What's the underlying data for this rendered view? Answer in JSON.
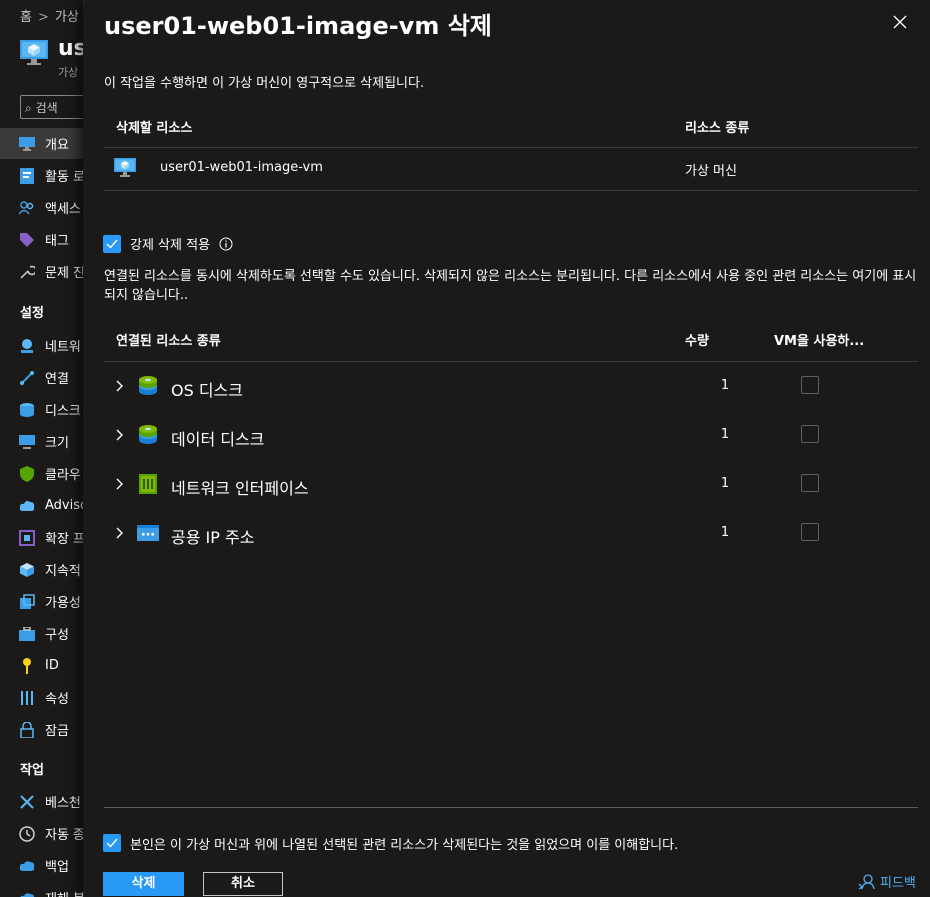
{
  "background": {
    "breadcrumb": [
      "홈",
      "가상"
    ],
    "title": "us",
    "subtitle": "가상",
    "search_placeholder": "검색",
    "nav": [
      {
        "label": "개요",
        "icon": "monitor-icon",
        "active": true
      },
      {
        "label": "활동 로",
        "icon": "activity-log-icon"
      },
      {
        "label": "액세스",
        "icon": "people-icon"
      },
      {
        "label": "태그",
        "icon": "tag-icon"
      },
      {
        "label": "문제 진",
        "icon": "wrench-icon"
      }
    ],
    "settings_header": "설정",
    "settings_nav": [
      {
        "label": "네트워",
        "icon": "network-icon"
      },
      {
        "label": "연결",
        "icon": "connect-icon"
      },
      {
        "label": "디스크",
        "icon": "disk-icon"
      },
      {
        "label": "크기",
        "icon": "monitor-icon"
      },
      {
        "label": "클라우",
        "icon": "shield-icon"
      },
      {
        "label": "Adviso",
        "icon": "advisor-icon"
      },
      {
        "label": "확장 프",
        "icon": "extension-icon"
      },
      {
        "label": "지속적",
        "icon": "cube-icon"
      },
      {
        "label": "가용성",
        "icon": "availability-icon"
      },
      {
        "label": "구성",
        "icon": "toolbox-icon"
      },
      {
        "label": "ID",
        "icon": "key-icon"
      },
      {
        "label": "속성",
        "icon": "properties-icon"
      },
      {
        "label": "잠금",
        "icon": "lock-icon"
      }
    ],
    "ops_header": "작업",
    "ops_nav": [
      {
        "label": "베스천",
        "icon": "bastion-icon"
      },
      {
        "label": "자동 종",
        "icon": "clock-icon"
      },
      {
        "label": "백업",
        "icon": "cloud-icon"
      },
      {
        "label": "재해 복",
        "icon": "cloud-icon"
      }
    ]
  },
  "dialog": {
    "title": "user01-web01-image-vm 삭제",
    "description": "이 작업을 수행하면 이 가상 머신이 영구적으로 삭제됩니다.",
    "resource_table": {
      "headers": [
        "삭제할 리소스",
        "리소스 종류"
      ],
      "rows": [
        {
          "name": "user01-web01-image-vm",
          "type": "가상 머신",
          "icon": "vm-icon"
        }
      ]
    },
    "force_delete": {
      "label": "강제 삭제 적용",
      "checked": true
    },
    "associated_text": "연결된 리소스를 동시에 삭제하도록 선택할 수도 있습니다. 삭제되지 않은 리소스는 분리됩니다. 다른 리소스에서 사용 중인 관련 리소스는 여기에 표시되지 않습니다..",
    "assoc_table": {
      "headers": [
        "연결된 리소스 종류",
        "수량",
        "VM을 사용하..."
      ],
      "rows": [
        {
          "label": "OS 디스크",
          "qty": "1",
          "icon": "disk-icon",
          "checked": false
        },
        {
          "label": "데이터 디스크",
          "qty": "1",
          "icon": "disk-icon",
          "checked": false
        },
        {
          "label": "네트워크 인터페이스",
          "qty": "1",
          "icon": "network-interface-icon",
          "checked": false
        },
        {
          "label": "공용 IP 주소",
          "qty": "1",
          "icon": "public-ip-icon",
          "checked": false
        }
      ]
    },
    "confirm": {
      "label": "본인은 이 가상 머신과 위에 나열된 선택된 관련 리소스가 삭제된다는 것을 읽었으며 이를 이해합니다.",
      "checked": true
    },
    "delete_button": "삭제",
    "cancel_button": "취소",
    "feedback": "피드백"
  },
  "colors": {
    "accent": "#2899f5",
    "background": "#1b1a19",
    "link": "#4db0f8"
  }
}
